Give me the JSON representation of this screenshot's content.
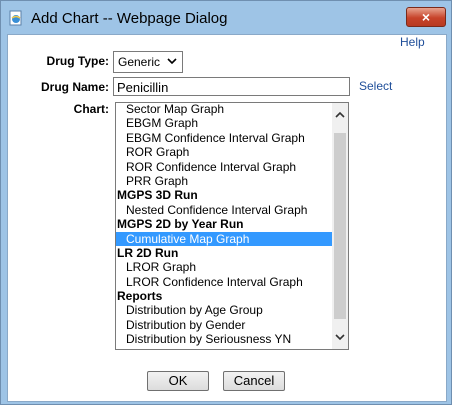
{
  "window": {
    "title": "Add Chart -- Webpage Dialog",
    "close_label": "×"
  },
  "help": {
    "label": "Help"
  },
  "form": {
    "drug_type": {
      "label": "Drug Type:",
      "value": "Generic"
    },
    "drug_name": {
      "label": "Drug Name:",
      "value": "Penicillin",
      "select_label": "Select"
    },
    "chart": {
      "label": "Chart:"
    }
  },
  "chart_list": {
    "items": [
      {
        "label": "Sector Map Graph",
        "kind": "option"
      },
      {
        "label": "EBGM Graph",
        "kind": "option"
      },
      {
        "label": "EBGM Confidence Interval Graph",
        "kind": "option"
      },
      {
        "label": "ROR Graph",
        "kind": "option"
      },
      {
        "label": "ROR Confidence Interval Graph",
        "kind": "option"
      },
      {
        "label": "PRR Graph",
        "kind": "option"
      },
      {
        "label": "MGPS 3D Run",
        "kind": "group"
      },
      {
        "label": "Nested Confidence Interval Graph",
        "kind": "option"
      },
      {
        "label": "MGPS 2D by Year Run",
        "kind": "group"
      },
      {
        "label": "Cumulative Map Graph",
        "kind": "option",
        "selected": true
      },
      {
        "label": "LR 2D Run",
        "kind": "group"
      },
      {
        "label": "LROR Graph",
        "kind": "option"
      },
      {
        "label": "LROR Confidence Interval Graph",
        "kind": "option"
      },
      {
        "label": "Reports",
        "kind": "group"
      },
      {
        "label": "Distribution by Age Group",
        "kind": "option"
      },
      {
        "label": "Distribution by Gender",
        "kind": "option"
      },
      {
        "label": "Distribution by Seriousness YN",
        "kind": "option"
      }
    ]
  },
  "buttons": {
    "ok": "OK",
    "cancel": "Cancel"
  },
  "colors": {
    "selection": "#3399ff",
    "link": "#1f4e99",
    "title_bar": "#9ec4e6"
  },
  "icons": {
    "app": "ie-page-icon",
    "close": "close-icon",
    "dropdown": "chevron-down-icon"
  }
}
